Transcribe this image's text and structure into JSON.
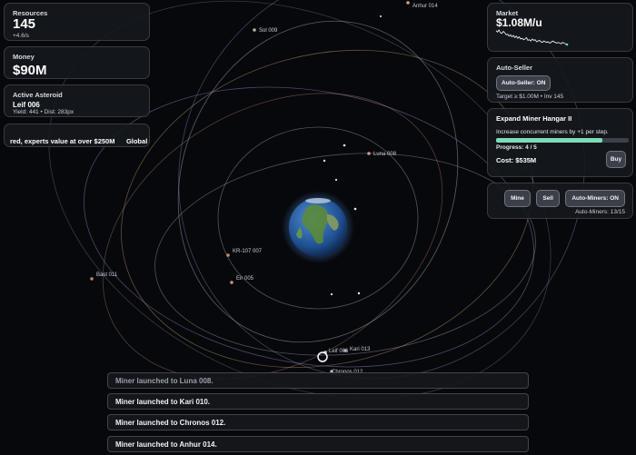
{
  "resources": {
    "label": "Resources",
    "value": "145",
    "rate": "+4.6/s"
  },
  "money": {
    "label": "Money",
    "value": "$90M"
  },
  "asteroid": {
    "label": "Active Asteroid",
    "name": "Leif 006",
    "stats": "Yield: 441 • Dist: 283px"
  },
  "ticker": {
    "text": "red, experts value at over $250M",
    "tag": "Global"
  },
  "market": {
    "label": "Market",
    "price": "$1.08M/u",
    "history": [
      30,
      28,
      31,
      27,
      26,
      29,
      27,
      24,
      25,
      22,
      24,
      21,
      23,
      20,
      22,
      19,
      21,
      18,
      19,
      17,
      18,
      20,
      16,
      17,
      15,
      18,
      16,
      17,
      14,
      15,
      16,
      14,
      13,
      15,
      14,
      13,
      14,
      12,
      13,
      15,
      14,
      13,
      12,
      13,
      12,
      11,
      13,
      12,
      11,
      10
    ]
  },
  "autoseller": {
    "label": "Auto-Seller",
    "button": "Auto-Seller: ON",
    "target": "Target ≥ $1.00M • Inv 145"
  },
  "upgrade": {
    "title": "Expand Miner Hangar II",
    "desc": "Increase concurrent miners by +1 per step.",
    "progress_label": "Progress: 4 / 5",
    "progress": 0.8,
    "cost": "Cost: $535M",
    "buy": "Buy"
  },
  "actions": {
    "mine": "Mine",
    "sell": "Sell",
    "auto": "Auto-Miners: ON",
    "count": "Auto-Miners: 13/15"
  },
  "log": [
    "Miner launched to Luna 008.",
    "Miner launched to Kari 010.",
    "Miner launched to Chronos 012.",
    "Miner launched to Anhur 014."
  ],
  "bodies": [
    {
      "name": "Anhur 014"
    },
    {
      "name": "Sol 009"
    },
    {
      "name": "Luna 008"
    },
    {
      "name": "KR-107 007"
    },
    {
      "name": "Eir 005"
    },
    {
      "name": "Bast 011"
    },
    {
      "name": "Leif 006"
    },
    {
      "name": "Kari 013"
    },
    {
      "name": "Chronos 012"
    }
  ],
  "colors": {
    "accent": "#6fd3a8",
    "progress_fill": "#7ddbb8"
  }
}
